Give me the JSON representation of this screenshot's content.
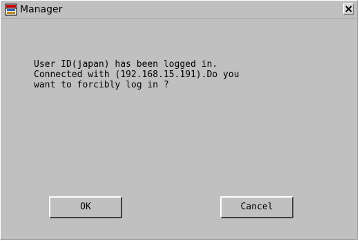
{
  "window": {
    "title": "Manager",
    "icon": "manager-app-icon",
    "close_icon": "close-icon"
  },
  "dialog": {
    "message": "User ID(japan) has been logged in.\nConnected with (192.168.15.191).Do you\nwant to forcibly log in ?"
  },
  "buttons": {
    "ok_label": "OK",
    "cancel_label": "Cancel"
  },
  "colors": {
    "background": "#c0c0c0",
    "text": "#000000"
  }
}
